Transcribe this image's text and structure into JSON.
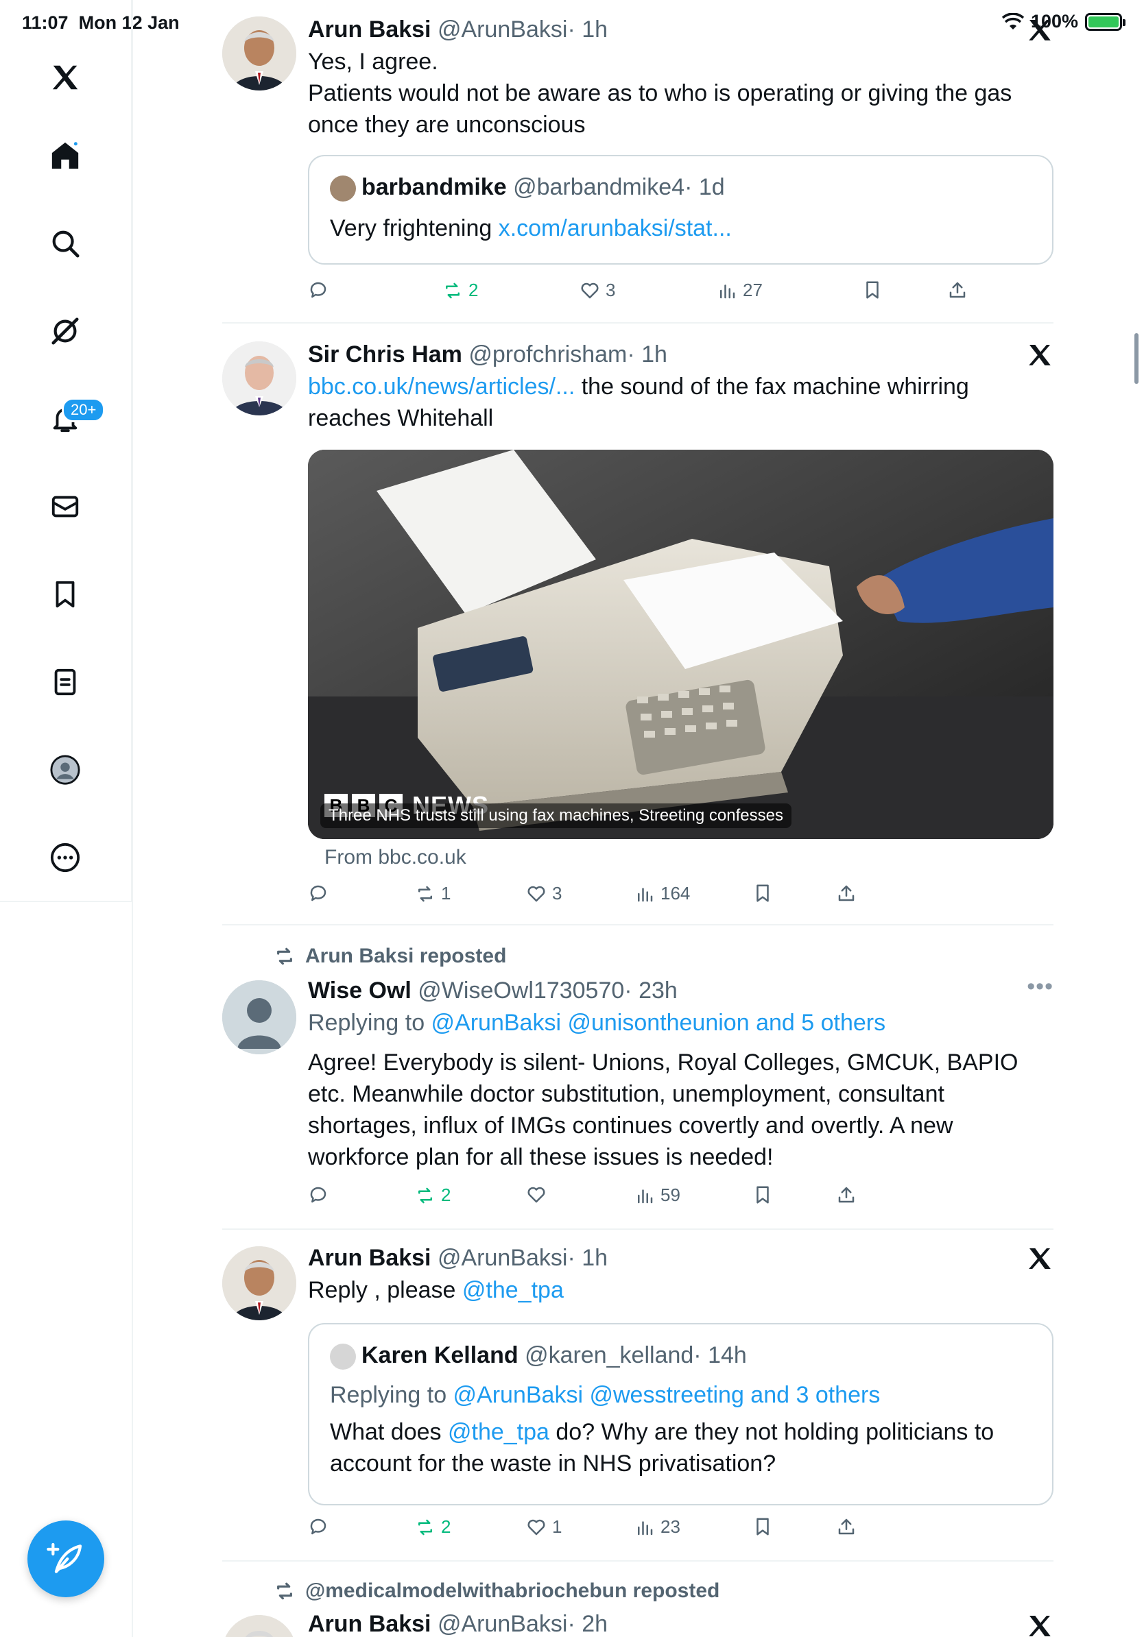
{
  "status_bar": {
    "time": "11:07",
    "date": "Mon 12 Jan",
    "battery": "100%"
  },
  "sidebar": {
    "notifications_badge": "20+",
    "items": [
      "x-logo",
      "home",
      "search",
      "grok",
      "notifications",
      "messages",
      "bookmarks",
      "lists",
      "profile",
      "more"
    ]
  },
  "tweets": [
    {
      "name": "Arun Baksi",
      "handle": "@ArunBaksi",
      "time": "· 1h",
      "line1": "Yes, I agree.",
      "line2": "Patients would not be aware as to who is operating or giving the gas once they are unconscious",
      "quote": {
        "name": "barbandmike",
        "handle": "@barbandmike4",
        "time": "· 1d",
        "text": "Very frightening ",
        "link": "x.com/arunbaksi/stat..."
      },
      "replies": "",
      "reposts": "2",
      "likes": "3",
      "views": "27"
    },
    {
      "name": "Sir Chris Ham",
      "handle": "@profchrisham",
      "time": "· 1h",
      "link": "bbc.co.uk/news/articles/...",
      "text": " the sound of the fax machine whirring reaches Whitehall",
      "card_caption": "Three NHS trusts still using fax machines, Streeting confesses",
      "card_logo": [
        "B",
        "B",
        "C"
      ],
      "card_logo_news": "NEWS",
      "card_source": "From bbc.co.uk",
      "replies": "",
      "reposts": "1",
      "likes": "3",
      "views": "164"
    },
    {
      "repost_label": "Arun Baksi reposted",
      "name": "Wise Owl",
      "handle": "@WiseOwl1730570",
      "time": "· 23h",
      "replying_prefix": "Replying to ",
      "replying_to": "@ArunBaksi @unisontheunion and 5 others",
      "text": "Agree! Everybody is silent- Unions, Royal Colleges, GMCUK, BAPIO etc. Meanwhile doctor substitution, unemployment, consultant shortages, influx of IMGs continues covertly and overtly. A new workforce plan for all these issues is needed!",
      "replies": "",
      "reposts": "2",
      "likes": "",
      "views": "59"
    },
    {
      "name": "Arun Baksi",
      "handle": "@ArunBaksi",
      "time": "· 1h",
      "text_prefix": "Reply , please ",
      "text_mention": "@the_tpa",
      "quote": {
        "name": "Karen Kelland",
        "handle": "@karen_kelland",
        "time": "· 14h",
        "replying_prefix": "Replying to ",
        "replying_to": "@ArunBaksi @wesstreeting and 3 others",
        "text_a": "What does ",
        "mention": "@the_tpa",
        "text_b": " do? Why are they not holding politicians to account for the waste in NHS privatisation?"
      },
      "replies": "",
      "reposts": "2",
      "likes": "1",
      "views": "23"
    },
    {
      "repost_label": "@medicalmodelwithabriochebun reposted",
      "name": "Arun Baksi",
      "handle": "@ArunBaksi",
      "time": "· 2h"
    }
  ],
  "colors": {
    "accent": "#1d9bf0",
    "repost_green": "#00ba7c",
    "muted": "#536471",
    "border": "#cfd9de"
  }
}
